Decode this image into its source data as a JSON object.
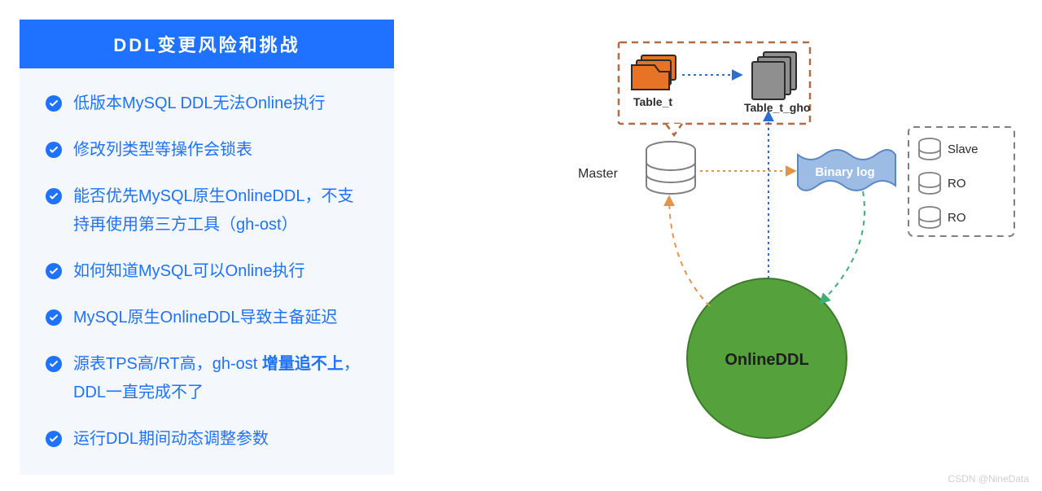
{
  "panel": {
    "title": "DDL变更风险和挑战",
    "items": [
      {
        "text": "低版本MySQL DDL无法Online执行"
      },
      {
        "text": "修改列类型等操作会锁表"
      },
      {
        "text": "能否优先MySQL原生OnlineDDL，不支持再使用第三方工具（gh-ost）"
      },
      {
        "text": "如何知道MySQL可以Online执行"
      },
      {
        "text": "MySQL原生OnlineDDL导致主备延迟"
      },
      {
        "text_pre": "源表TPS高/RT高，gh-ost ",
        "bold": "增量追不上",
        "text_post": "，DDL一直完成不了"
      },
      {
        "text": "运行DDL期间动态调整参数"
      }
    ]
  },
  "diagram": {
    "master_label": "Master",
    "table_t_label": "Table_t",
    "table_t_gho_label": "Table_t_gho",
    "binary_log_label": "Binary log",
    "online_ddl_label": "OnlineDDL",
    "replicas": [
      "Slave",
      "RO",
      "RO"
    ]
  },
  "watermark": "CSDN @NineData"
}
